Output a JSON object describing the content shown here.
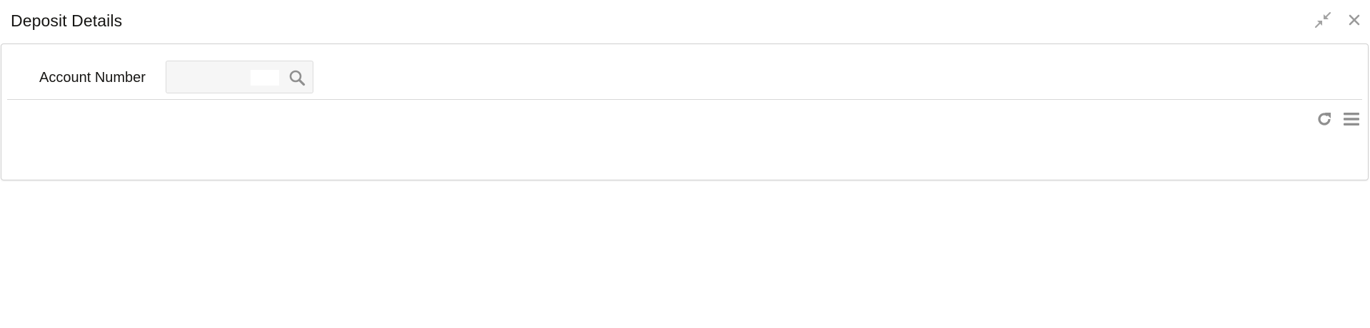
{
  "window": {
    "title": "Deposit Details",
    "controls": {
      "minimize_icon": "minimize-arrows-icon",
      "close_icon": "close-icon"
    }
  },
  "form": {
    "account_number": {
      "label": "Account Number",
      "value": "",
      "placeholder": "",
      "search_icon": "search-icon"
    }
  },
  "grid_toolbar": {
    "refresh_icon": "refresh-icon",
    "menu_icon": "menu-icon"
  },
  "colors": {
    "icon_gray": "#8f8f8f",
    "border": "#d0d0d0",
    "field_bg": "#f6f6f6"
  }
}
